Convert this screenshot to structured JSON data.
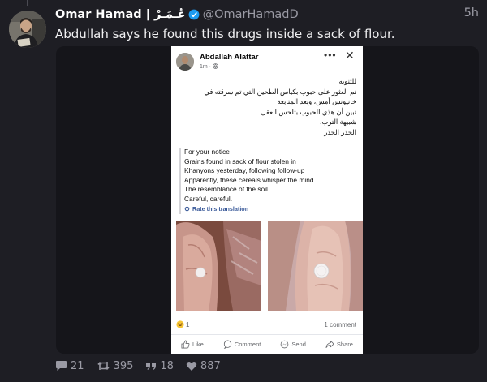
{
  "post": {
    "author_name": "Omar Hamad | عُـمَـرْ",
    "handle": "@OmarHamadD",
    "time": "5h",
    "text": "Abdullah says he found this drugs inside a sack of flour."
  },
  "embedded": {
    "author": "Abdallah Alattar",
    "meta": "1m · ",
    "more_label": "•••",
    "close_label": "✕",
    "arabic_lines": [
      "للتنويه",
      "تم العثور على حبوب بكياس الطحين التي تم سرقته في",
      "خانيونس أمس، وبعد المتابعة",
      "تبين أن هذي الحبوب بتلحس العقل",
      "شبيهة الترب.",
      "الحذر الحذر"
    ],
    "translation_lines": [
      "For your notice",
      "Grains found in sack of flour stolen in",
      "Khanyons yesterday, following follow-up",
      "Apparently, these cereals whisper the mind.",
      "The resemblance of the soil.",
      "Careful, careful."
    ],
    "rate_label": "Rate this translation",
    "reaction_count": "1",
    "comment_count": "1 comment",
    "actions": {
      "like": "Like",
      "comment": "Comment",
      "send": "Send",
      "share": "Share"
    }
  },
  "stats": {
    "replies": "21",
    "retweets": "395",
    "quotes": "18",
    "likes": "887"
  },
  "colors": {
    "background": "#1e1e24",
    "verified": "#1d9bf0",
    "link_blue": "#385898"
  }
}
